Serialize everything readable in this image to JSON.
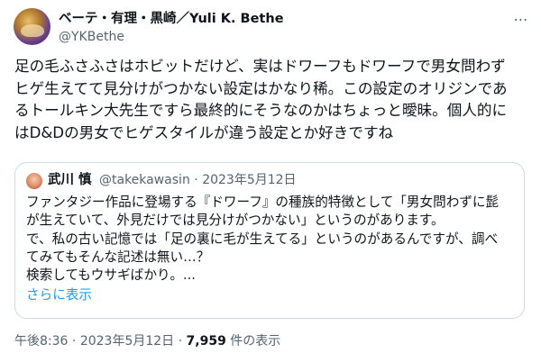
{
  "author": {
    "display_name": "ベーテ・有理・黒崎／Yuli K. Bethe",
    "handle": "@YKBethe"
  },
  "more_icon": "⋯",
  "tweet_lines": [
    "足の毛ふさふさはホビットだけど、実はドワーフもドワーフで男女問わず",
    "ヒゲ生えてて見分けがつかない設定はかなり稀。この設定のオリジンであ",
    "るトールキン大先生ですら最終的にそうなのかはちょっと曖昧。個人的に",
    "はD&Dの男女でヒゲスタイルが違う設定とか好きですね"
  ],
  "quote": {
    "display_name": "武川 慎",
    "handle": "@takekawasin",
    "separator": "·",
    "date": "2023年5月12日",
    "lines": [
      "ファンタジー作品に登場する『ドワーフ』の種族的特徴として「男女問わずに髭",
      "が生えていて、外見だけでは見分けがつかない」というのがあります。",
      "で、私の古い記憶では「足の裏に毛が生えてる」というのがあるんですが、調べ",
      "てみてもそんな記述は無い…？",
      "検索してもウサギばかり。..."
    ],
    "show_more": "さらに表示"
  },
  "footer": {
    "time": "午後8:36",
    "sep1": "·",
    "date": "2023年5月12日",
    "sep2": "·",
    "views_count": "7,959",
    "views_label": "件の表示"
  },
  "colors": {
    "text": "#0f1419",
    "muted": "#536471",
    "link": "#1d9bf0",
    "border": "#cfd9de"
  }
}
